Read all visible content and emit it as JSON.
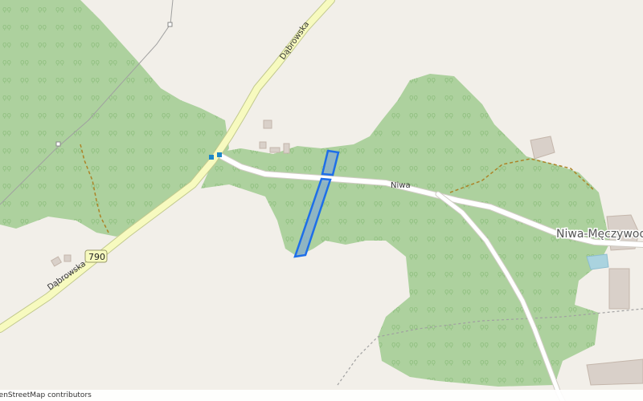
{
  "map": {
    "colors": {
      "background": "#f2efe9",
      "forest": "#add19e",
      "forest_tree": "#8fbf7f",
      "highway": "#f7fabf",
      "highway_casing": "#c2c98e",
      "track": "#ac8327",
      "railway": "#a0a0a0",
      "parcel_fill": "#8ab0c8",
      "parcel_stroke": "#1e6fe8",
      "building": "#d9d0c9",
      "water": "#aad3df"
    },
    "labels": {
      "road_dabrowska_north": "Dąbrowska",
      "road_dabrowska_south": "Dąbrowska",
      "road_niwa": "Niwa",
      "place_niwa": "Niwa-Męczywoda",
      "route_shield": "790"
    },
    "attribution": "© OpenStreetMap contributors"
  }
}
